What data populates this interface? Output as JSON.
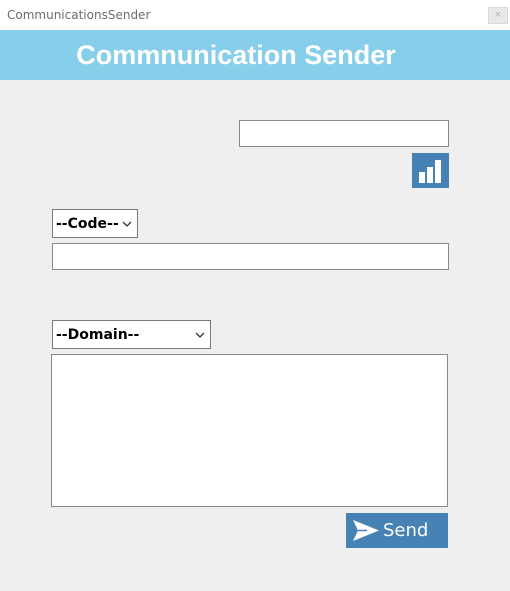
{
  "window": {
    "title": "CommunicationsSender",
    "close_glyph": "×"
  },
  "header": {
    "title": "Commnunication Sender",
    "background": "#87ceeb"
  },
  "top_input": {
    "value": ""
  },
  "stats_button": {
    "icon": "bar-chart-icon",
    "color": "#4682b4"
  },
  "code_select": {
    "selected": "--Code--"
  },
  "code_input": {
    "value": ""
  },
  "domain_select": {
    "selected": "--Domain--"
  },
  "message_textarea": {
    "value": ""
  },
  "send_button": {
    "label": "Send",
    "icon": "send-icon",
    "color": "#4682b4"
  }
}
